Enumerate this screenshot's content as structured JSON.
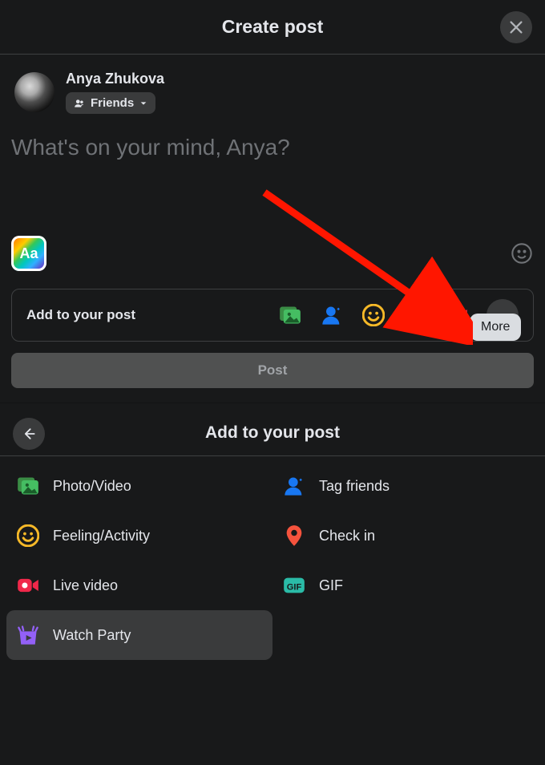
{
  "header": {
    "title": "Create post"
  },
  "user": {
    "name": "Anya Zhukova",
    "audience_label": "Friends"
  },
  "composer": {
    "placeholder": "What's on your mind, Anya?",
    "bg_button_label": "Aa"
  },
  "addto_bar": {
    "label": "Add to your post",
    "more_tooltip": "More"
  },
  "post_button": {
    "label": "Post"
  },
  "section2": {
    "title": "Add to your post",
    "options": [
      {
        "label": "Photo/Video"
      },
      {
        "label": "Tag friends"
      },
      {
        "label": "Feeling/Activity"
      },
      {
        "label": "Check in"
      },
      {
        "label": "Live video"
      },
      {
        "label": "GIF"
      },
      {
        "label": "Watch Party"
      }
    ]
  },
  "colors": {
    "photo": "#45bd62",
    "tag": "#1877f2",
    "feeling": "#f7b928",
    "checkin": "#f5533d",
    "live": "#f0284a",
    "gif": "#2abba7",
    "watch": "#9360f7"
  }
}
